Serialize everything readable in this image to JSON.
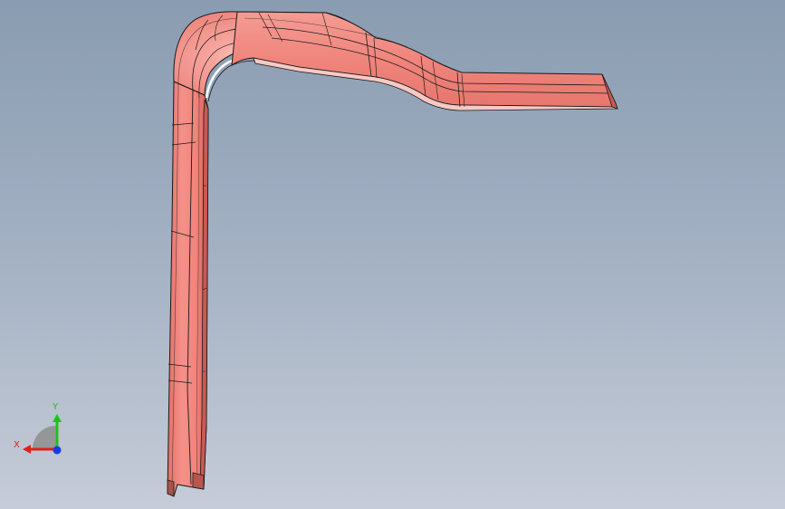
{
  "viewport": {
    "background_top": "#8a9cb1",
    "background_bottom": "#c6ccd8"
  },
  "model": {
    "part_color": "#f2897f",
    "highlight_color": "#fbb9b2",
    "shadow_color": "#d86a62",
    "edge_color": "#1a1a1a"
  },
  "triad": {
    "x_label": "X",
    "y_label": "Y",
    "x_color": "#e0201a",
    "y_color": "#22c020",
    "z_color": "#1a3ce0"
  }
}
